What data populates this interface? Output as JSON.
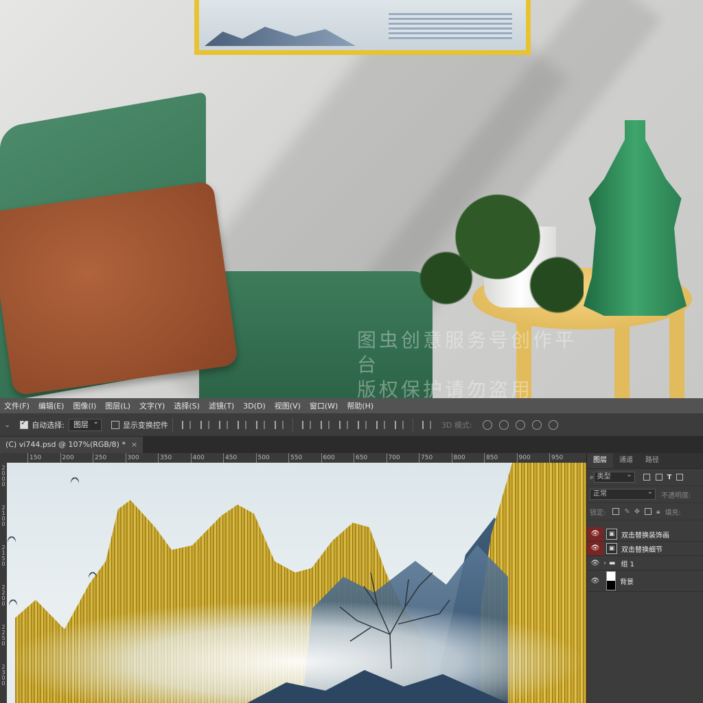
{
  "room": {
    "watermark_line1": "图虫创意服务号创作平台",
    "watermark_line2": "版权保护请勿盗用"
  },
  "menubar": {
    "items": [
      "文件(F)",
      "编辑(E)",
      "图像(I)",
      "图层(L)",
      "文字(Y)",
      "选择(S)",
      "滤镜(T)",
      "3D(D)",
      "视图(V)",
      "窗口(W)",
      "帮助(H)"
    ]
  },
  "options": {
    "auto_select_label": "自动选择:",
    "auto_select_value": "图层",
    "show_transform_label": "显示变换控件",
    "mode_3d_label": "3D 模式:"
  },
  "document_tab": {
    "title": "(C) vi744.psd @ 107%(RGB/8) *",
    "close": "×"
  },
  "ruler": {
    "h_ticks": [
      "150",
      "200",
      "250",
      "300",
      "350",
      "400",
      "450",
      "500",
      "550",
      "600",
      "650",
      "700",
      "750",
      "800",
      "850",
      "900",
      "950"
    ],
    "v_ticks": [
      "2000",
      "2100",
      "2150",
      "2200",
      "2250",
      "2300"
    ]
  },
  "layers_panel": {
    "tabs": [
      "图层",
      "通道",
      "路径"
    ],
    "filter_label": "类型",
    "blend_mode": "正常",
    "opacity_label": "不透明度:",
    "lock_label": "锁定:",
    "fill_label": "填充:",
    "layers": [
      {
        "name": "双击替换装饰画",
        "highlight": true,
        "type": "smart-object"
      },
      {
        "name": "双击替换细节",
        "highlight": true,
        "type": "smart-object"
      },
      {
        "name": "组 1",
        "highlight": false,
        "type": "group"
      },
      {
        "name": "背景",
        "highlight": false,
        "type": "background"
      }
    ]
  },
  "colors": {
    "menubar": "#535353",
    "panel": "#3c3c3c",
    "highlight_eye": "#7a2424",
    "gold": "#d9b943"
  }
}
